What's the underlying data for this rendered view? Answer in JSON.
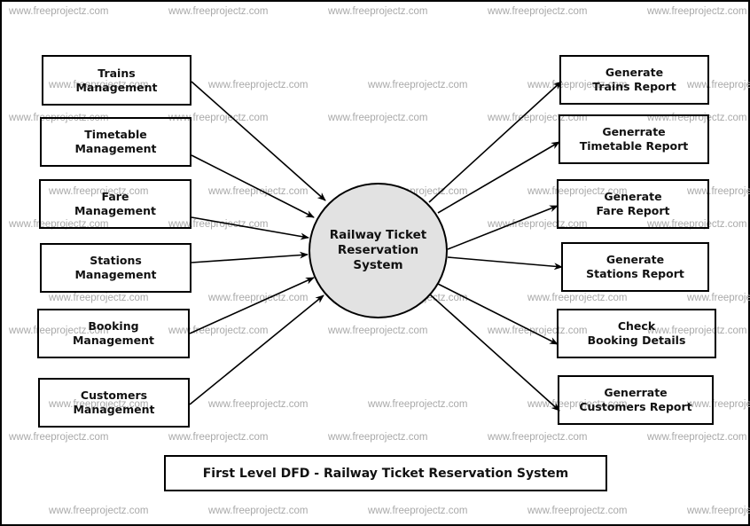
{
  "diagram": {
    "title": "First Level DFD - Railway Ticket Reservation System",
    "watermark": "www.freeprojectz.com",
    "process": {
      "label": "Railway Ticket\nReservation\nSystem",
      "fill": "#e2e2e2"
    },
    "inputs": [
      {
        "id": "trains",
        "label": "Trains\nManagement"
      },
      {
        "id": "timetable",
        "label": "Timetable\nManagement"
      },
      {
        "id": "fare",
        "label": "Fare\nManagement"
      },
      {
        "id": "stations",
        "label": "Stations\nManagement"
      },
      {
        "id": "booking",
        "label": "Booking\nManagement"
      },
      {
        "id": "customers",
        "label": "Customers\nManagement"
      }
    ],
    "outputs": [
      {
        "id": "trains-report",
        "label": "Generate\nTrains Report"
      },
      {
        "id": "timetable-report",
        "label": "Generrate\nTimetable Report"
      },
      {
        "id": "fare-report",
        "label": "Generate\nFare Report"
      },
      {
        "id": "stations-report",
        "label": "Generate\nStations Report"
      },
      {
        "id": "booking-details",
        "label": "Check\nBooking Details"
      },
      {
        "id": "customers-report",
        "label": "Generrate\nCustomers Report"
      }
    ]
  }
}
